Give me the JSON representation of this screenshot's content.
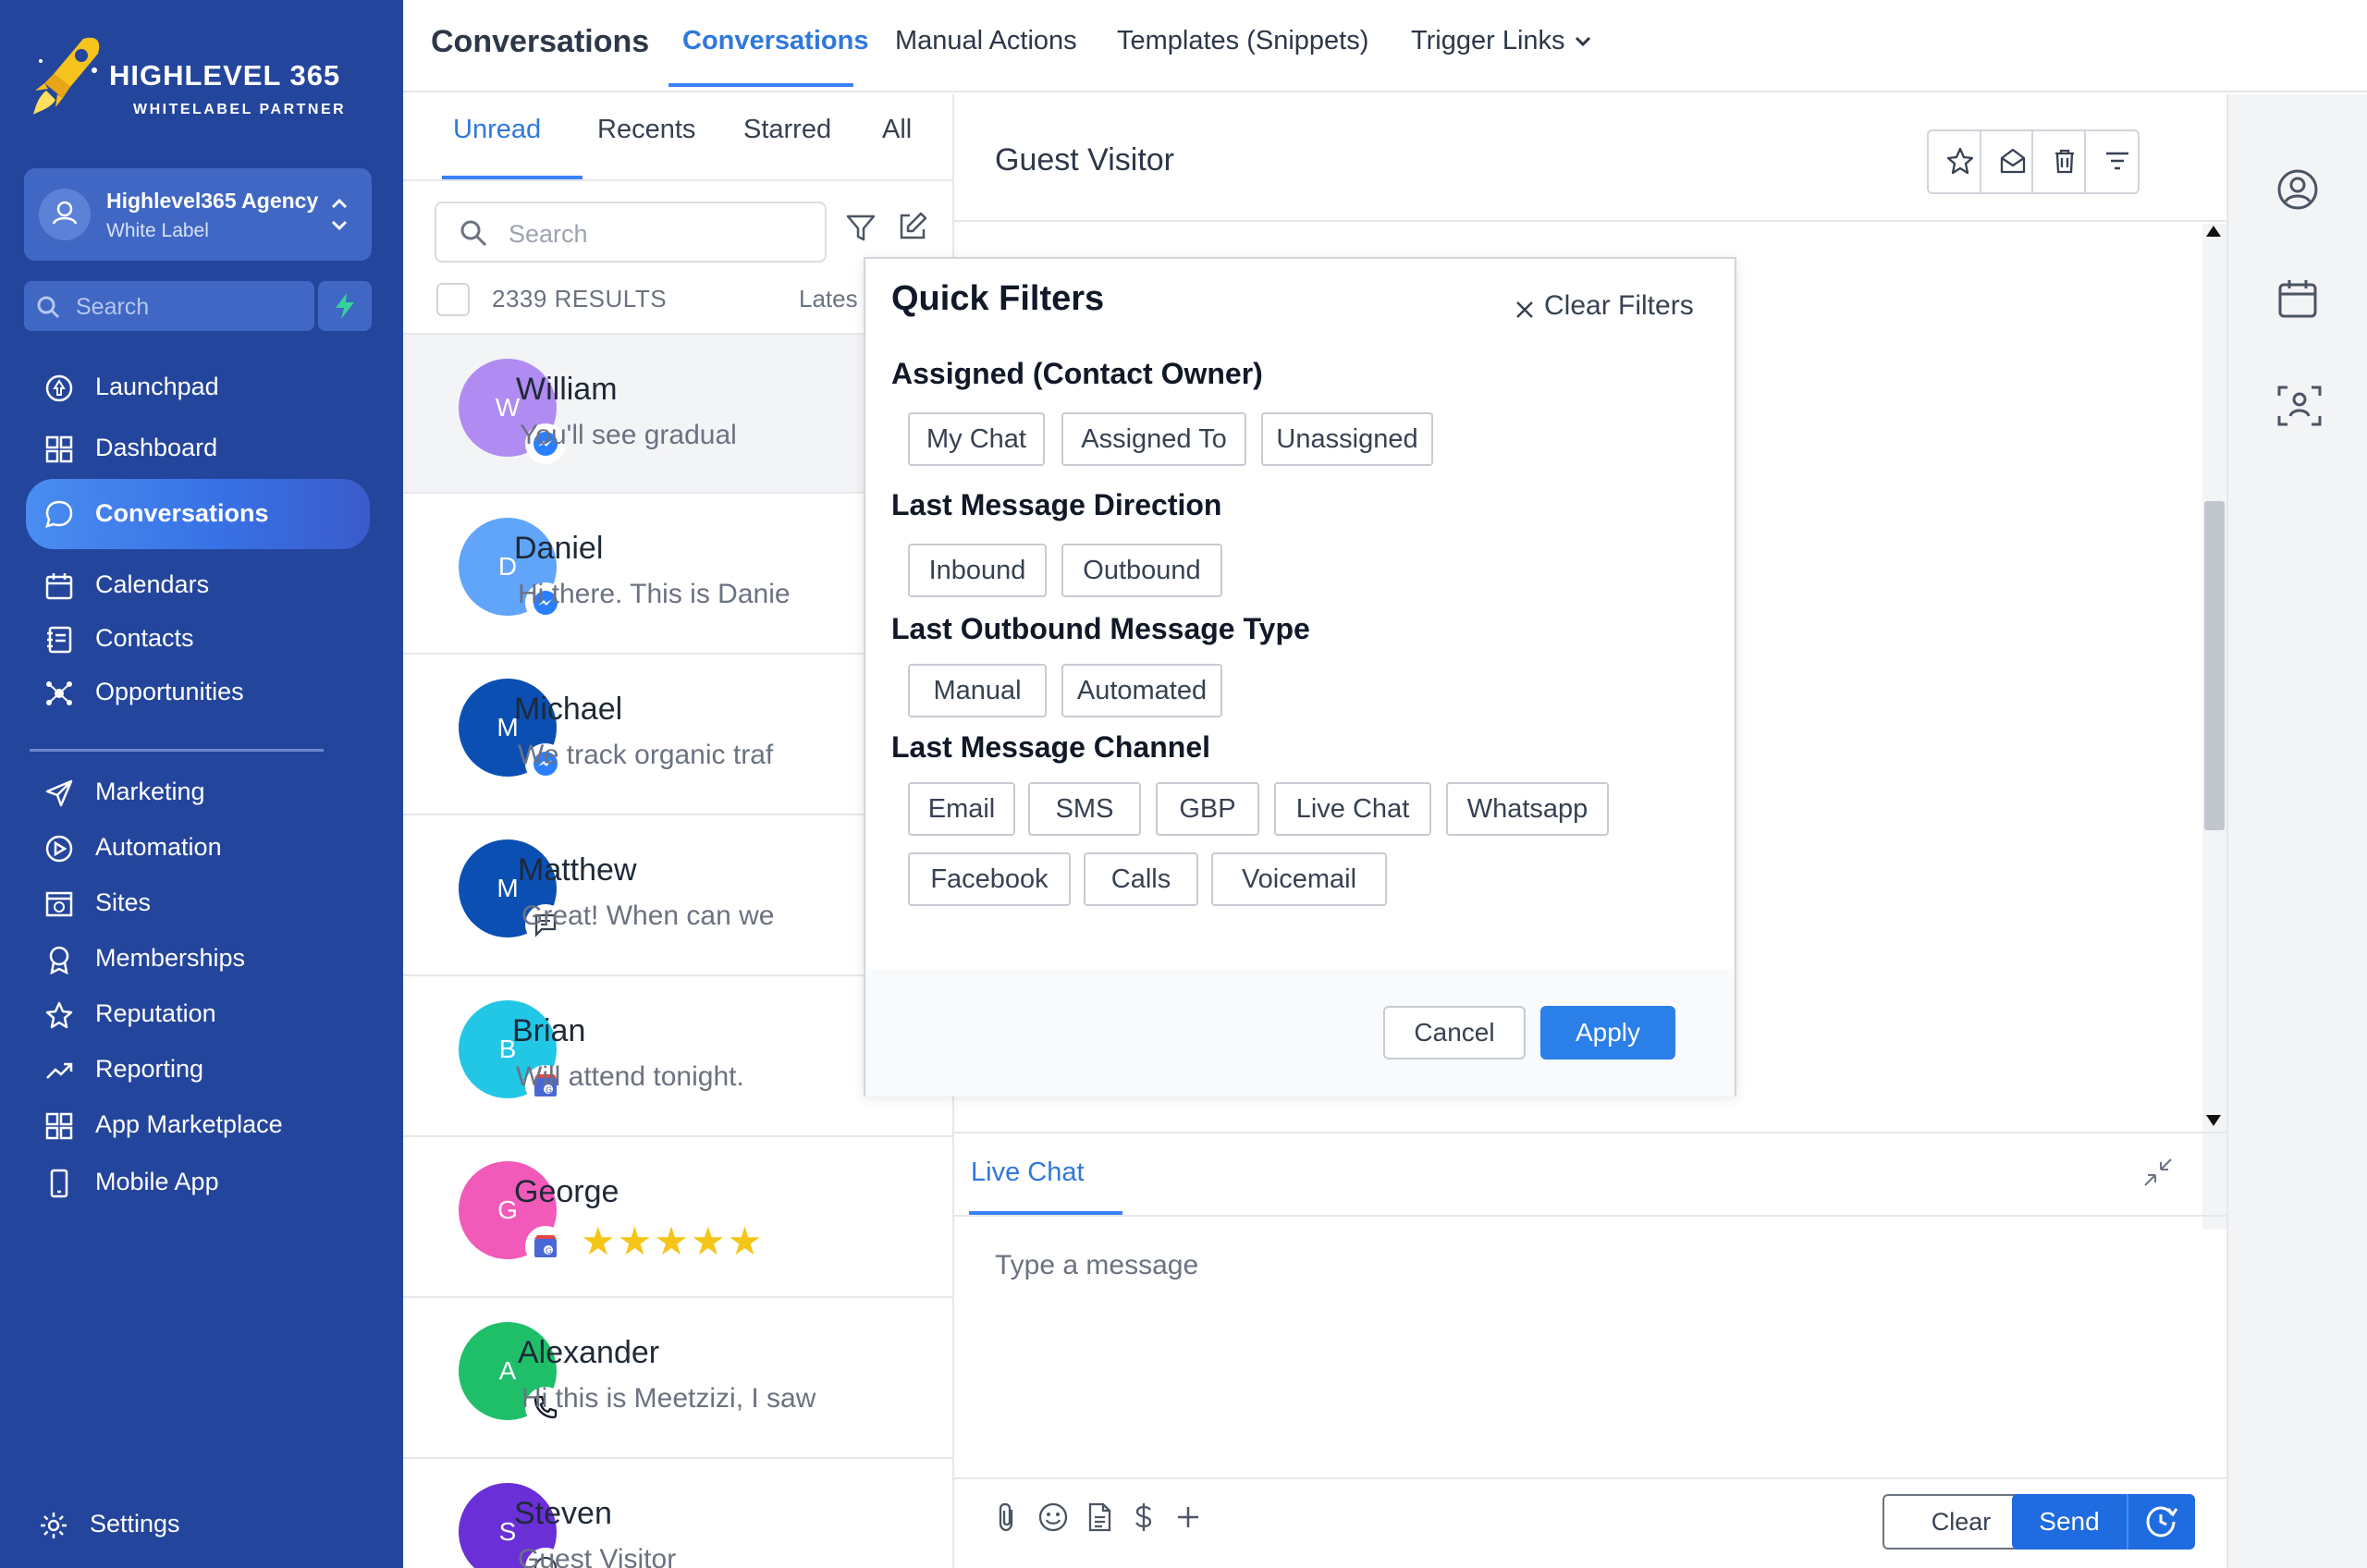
{
  "colors": {
    "sidebar_bg": "#24459c",
    "accent": "#3b82f6",
    "apply_button": "#2a7fe8",
    "send_button": "#1f6be0",
    "star": "#f5c518"
  },
  "brand": {
    "title": "HIGHLEVEL 365",
    "subtitle": "WHITELABEL PARTNER"
  },
  "agency": {
    "name": "Highlevel365 Agency",
    "subtitle": "White Label"
  },
  "sidebar": {
    "search_placeholder": "Search",
    "items": [
      {
        "label": "Launchpad",
        "icon": "rocket-icon"
      },
      {
        "label": "Dashboard",
        "icon": "grid-icon"
      },
      {
        "label": "Conversations",
        "icon": "chat-bubble-icon",
        "active": true
      },
      {
        "label": "Calendars",
        "icon": "calendar-icon"
      },
      {
        "label": "Contacts",
        "icon": "contacts-icon"
      },
      {
        "label": "Opportunities",
        "icon": "opportunities-icon"
      },
      {
        "label": "Marketing",
        "icon": "send-icon"
      },
      {
        "label": "Automation",
        "icon": "automation-icon"
      },
      {
        "label": "Sites",
        "icon": "sites-icon"
      },
      {
        "label": "Memberships",
        "icon": "award-icon"
      },
      {
        "label": "Reputation",
        "icon": "star-icon"
      },
      {
        "label": "Reporting",
        "icon": "trending-up-icon"
      },
      {
        "label": "App Marketplace",
        "icon": "apps-icon"
      },
      {
        "label": "Mobile App",
        "icon": "phone-icon"
      }
    ],
    "settings_label": "Settings"
  },
  "topbar": {
    "title": "Conversations",
    "tabs": [
      {
        "label": "Conversations",
        "active": true
      },
      {
        "label": "Manual Actions"
      },
      {
        "label": "Templates (Snippets)"
      },
      {
        "label": "Trigger Links"
      }
    ]
  },
  "list": {
    "tabs": [
      "Unread",
      "Recents",
      "Starred",
      "All"
    ],
    "active_tab": "Unread",
    "search_placeholder": "Search",
    "results_label": "2339 RESULTS",
    "sort_label": "Lates",
    "conversations": [
      {
        "initial": "W",
        "name": "William",
        "preview": "You'll see gradual",
        "channel": "messenger-icon",
        "avatar_color": "#b08cf2",
        "selected": true
      },
      {
        "initial": "D",
        "name": "Daniel",
        "preview": "Hi there. This is Danie",
        "channel": "messenger-icon",
        "avatar_color": "#60a5fa"
      },
      {
        "initial": "M",
        "name": "Michael",
        "preview": "We track organic traf",
        "channel": "messenger-icon",
        "avatar_color": "#0b4fb3"
      },
      {
        "initial": "M",
        "name": "Matthew",
        "preview": "Great! When can we",
        "channel": "sms-icon",
        "avatar_color": "#0b4fb3"
      },
      {
        "initial": "B",
        "name": "Brian",
        "preview": "Will attend tonight.",
        "channel": "gbp-icon",
        "avatar_color": "#22c7e6"
      },
      {
        "initial": "G",
        "name": "George",
        "preview": "",
        "rating_stars": 5,
        "channel": "gbp-icon",
        "avatar_color": "#f25ab9"
      },
      {
        "initial": "A",
        "name": "Alexander",
        "preview": "Hi this is Meetzizi, I saw",
        "channel": "phone-icon",
        "avatar_color": "#1fbf6a"
      },
      {
        "initial": "S",
        "name": "Steven",
        "preview": "Guest Visitor",
        "channel": "chat-icon",
        "avatar_color": "#6a2fd6"
      }
    ]
  },
  "main": {
    "contact_name": "Guest Visitor",
    "toolbar_icons": [
      "star-icon",
      "mail-open-icon",
      "trash-icon",
      "filter-lines-icon"
    ],
    "composer": {
      "channel_tab": "Live Chat",
      "placeholder": "Type a message",
      "tool_icons": [
        "paperclip-icon",
        "emoji-icon",
        "document-icon",
        "dollar-icon",
        "plus-icon"
      ],
      "clear_label": "Clear",
      "send_label": "Send"
    }
  },
  "quick_filters": {
    "title": "Quick Filters",
    "clear_label": "Clear Filters",
    "sections": [
      {
        "title": "Assigned (Contact Owner)",
        "chips": [
          "My Chat",
          "Assigned To",
          "Unassigned"
        ]
      },
      {
        "title": "Last Message Direction",
        "chips": [
          "Inbound",
          "Outbound"
        ]
      },
      {
        "title": "Last Outbound Message Type",
        "chips": [
          "Manual",
          "Automated"
        ]
      },
      {
        "title": "Last Message Channel",
        "chips": [
          "Email",
          "SMS",
          "GBP",
          "Live Chat",
          "Whatsapp",
          "Facebook",
          "Calls",
          "Voicemail"
        ]
      }
    ],
    "cancel_label": "Cancel",
    "apply_label": "Apply"
  },
  "right_rail": {
    "icons": [
      "user-circle-icon",
      "calendar-icon",
      "team-icon"
    ]
  }
}
